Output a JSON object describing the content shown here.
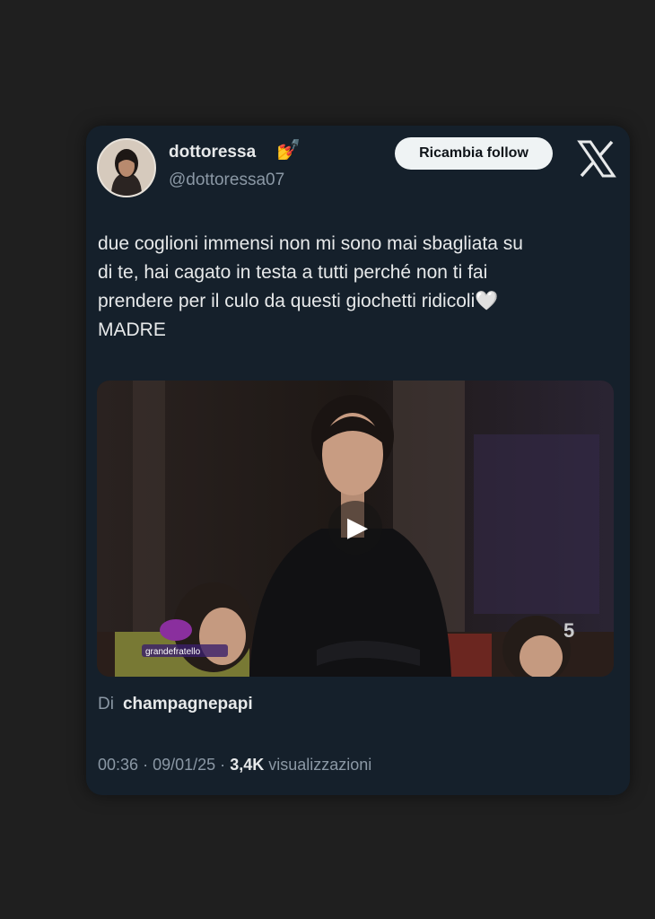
{
  "tweet": {
    "display_name": "dottoressa",
    "name_emoji": "💅",
    "handle": "@dottoressa07",
    "follow_button_label": "Ricambia follow",
    "brand_icon": "x-logo-icon",
    "text": "due coglioni immensi non mi sono mai sbagliata su\ndi te, hai cagato in testa a tutti perché non ti fai\nprendere per il culo da questi giochetti ridicoli🤍\nMADRE",
    "media": {
      "type": "video",
      "play_icon": "play-icon",
      "overlay_logo_text": "grandefratello",
      "channel_badge": "5"
    },
    "via_prefix": "Di",
    "via_user": "champagnepapi",
    "time": "00:36",
    "separator": "·",
    "date": "09/01/25",
    "views_count": "3,4K",
    "views_label": "visualizzazioni"
  }
}
